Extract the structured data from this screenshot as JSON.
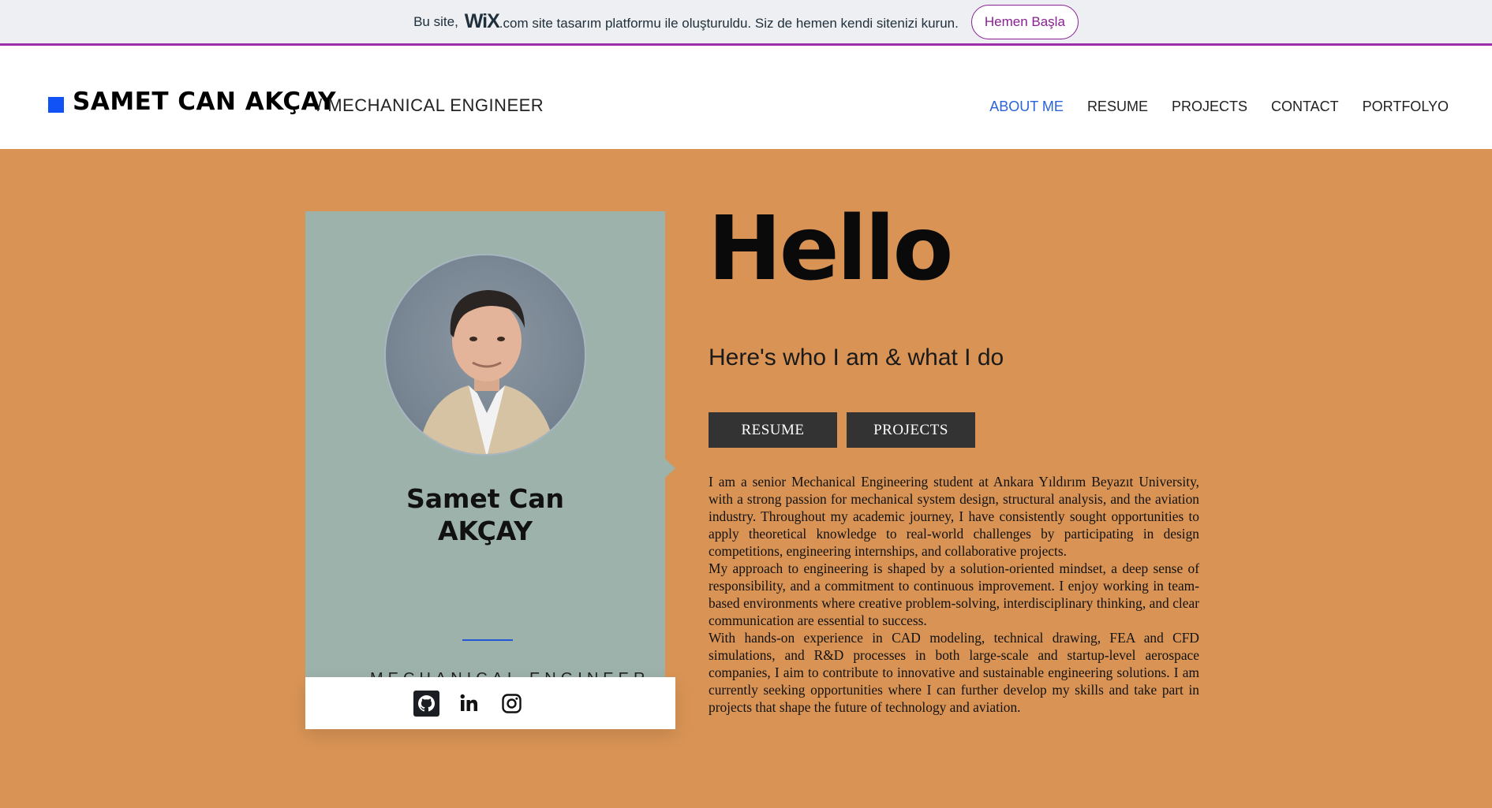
{
  "wix_banner": {
    "text_before": "Bu site,",
    "logo": "WiX",
    "text_after": ".com site tasarım platformu ile oluşturuldu. Siz de hemen kendi sitenizi kurun.",
    "cta_label": "Hemen Başla"
  },
  "header": {
    "brand_name": "SAMET CAN AKÇAY",
    "brand_subtitle": "/ MECHANICAL ENGINEER",
    "nav": [
      {
        "label": "ABOUT ME",
        "active": true
      },
      {
        "label": "RESUME",
        "active": false
      },
      {
        "label": "PROJECTS",
        "active": false
      },
      {
        "label": "CONTACT",
        "active": false
      },
      {
        "label": "PORTFOLYO",
        "active": false
      }
    ]
  },
  "card": {
    "name_line1": "Samet Can",
    "name_line2": "AKÇAY",
    "title": "MECHANICAL ENGINEER",
    "social": [
      {
        "icon": "github-icon"
      },
      {
        "icon": "linkedin-icon"
      },
      {
        "icon": "instagram-icon"
      }
    ]
  },
  "hero": {
    "heading": "Hello",
    "tagline": "Here's who I am & what I do",
    "resume_button": "RESUME",
    "projects_button": "PROJECTS"
  },
  "bio": {
    "paragraphs": [
      "I am a senior Mechanical Engineering student at Ankara Yıldırım Beyazıt University, with a strong passion for mechanical system design, structural analysis, and the aviation industry. Throughout my academic journey, I have consistently sought opportunities to apply theoretical knowledge to real-world challenges by participating in design competitions, engineering internships, and collaborative projects.",
      "My approach to engineering is shaped by a solution-oriented mindset, a deep sense of responsibility, and a commitment to continuous improvement. I enjoy working in team-based environments where creative problem-solving, interdisciplinary thinking, and clear communication are essential to success.",
      "With hands-on experience in CAD modeling, technical drawing, FEA and CFD simulations, and R&D processes in both large-scale and startup-level aerospace companies, I aim to contribute to innovative and sustainable engineering solutions. I am currently seeking opportunities where I can further develop my skills and take part in projects that shape the future of technology and aviation."
    ]
  },
  "colors": {
    "banner_bg": "#eeeff2",
    "banner_accent": "#8a1f93",
    "brand_accent": "#1052f5",
    "nav_active": "#2b63d9",
    "main_bg": "#d99455",
    "card_bg": "#9db2aa",
    "button_bg": "#333333"
  }
}
